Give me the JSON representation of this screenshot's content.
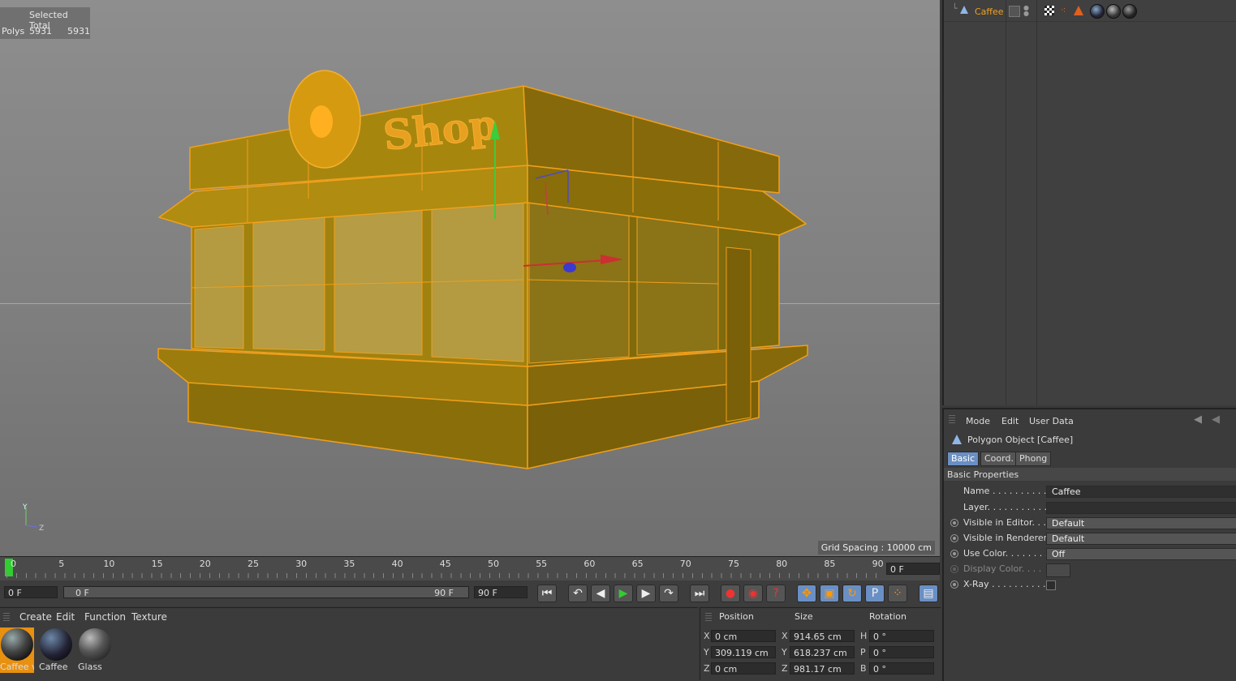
{
  "viewport": {
    "stats": {
      "header": "Selected Total",
      "row_label": "Polys",
      "selected": "5931",
      "total": "5931"
    },
    "grid_spacing": "Grid Spacing : 10000 cm",
    "shop_sign": "Shop",
    "axis_y": "Y",
    "axis_z": "Z"
  },
  "timeline": {
    "ticks": [
      "0",
      "5",
      "10",
      "15",
      "20",
      "25",
      "30",
      "35",
      "40",
      "45",
      "50",
      "55",
      "60",
      "65",
      "70",
      "75",
      "80",
      "85",
      "90"
    ],
    "current_frame": "0 F"
  },
  "transport": {
    "start_field": "0 F",
    "range_start": "0 F",
    "range_end": "90 F",
    "end_field": "90 F"
  },
  "material_manager": {
    "menu": [
      "Create",
      "Edit",
      "Function",
      "Texture"
    ],
    "materials": [
      "Caffee v",
      "Caffee",
      "Glass"
    ]
  },
  "coordinates": {
    "headers": [
      "Position",
      "Size",
      "Rotation"
    ],
    "rows": [
      {
        "pos_axis": "X",
        "pos": "0 cm",
        "size_axis": "X",
        "size": "914.65 cm",
        "rot_axis": "H",
        "rot": "0 °"
      },
      {
        "pos_axis": "Y",
        "pos": "309.119 cm",
        "size_axis": "Y",
        "size": "618.237 cm",
        "rot_axis": "P",
        "rot": "0 °"
      },
      {
        "pos_axis": "Z",
        "pos": "0 cm",
        "size_axis": "Z",
        "size": "981.17 cm",
        "rot_axis": "B",
        "rot": "0 °"
      }
    ]
  },
  "object_manager": {
    "object_name": "Caffee"
  },
  "attributes": {
    "menu": [
      "Mode",
      "Edit",
      "User Data"
    ],
    "title": "Polygon Object [Caffee]",
    "tabs": [
      "Basic",
      "Coord.",
      "Phong"
    ],
    "section": "Basic Properties",
    "props": [
      {
        "label": "Name . . . . . . . . . . .",
        "value": "Caffee"
      },
      {
        "label": "Layer. . . . . . . . . . .",
        "value": ""
      },
      {
        "label": "Visible in Editor. . .",
        "value": "Default"
      },
      {
        "label": "Visible in Renderer",
        "value": "Default"
      },
      {
        "label": "Use Color. . . . . . . .",
        "value": "Off"
      },
      {
        "label": "Display Color. . . .",
        "value": ""
      },
      {
        "label": "X-Ray . . . . . . . . . .",
        "value": ""
      }
    ]
  }
}
